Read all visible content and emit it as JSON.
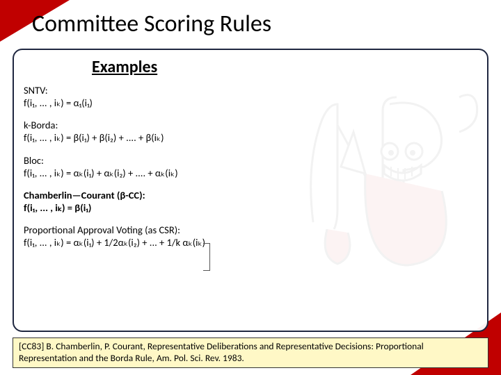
{
  "title": "Committee Scoring Rules",
  "examples_label": "Examples",
  "rules": {
    "sntv": {
      "name": "SNTV:",
      "formula": "f(i₁, ... , iₖ) = α₁(i₁)"
    },
    "kborda": {
      "name": "k-Borda:",
      "formula": "f(i₁, ... , iₖ) = β(i₁) + β(i₂) + .... + β(iₖ)"
    },
    "bloc": {
      "name": "Bloc:",
      "formula": "f(i₁, ... , iₖ) = αₖ(i₁) + αₖ(i₂) + .... + αₖ(iₖ)"
    },
    "cc": {
      "name": "Chamberlin—Courant (β-CC):",
      "formula": "f(i₁, ... , iₖ) = β(i₁)"
    },
    "pav": {
      "name": "Proportional Approval Voting (as CSR):",
      "formula": "f(i₁, ... , iₖ) = αₖ(i₁) + 1/2αₖ(i₂) + ... + 1/k αₖ(iₖ)"
    }
  },
  "citation": "[CC83] B. Chamberlin, P. Courant, Representative Deliberations and Representative Decisions: Proportional Representation and the Borda Rule, Am. Pol. Sci. Rev. 1983.",
  "colors": {
    "accent": "#c00000",
    "panel_border": "#1f2740",
    "cite_bg": "#fff8c6"
  }
}
